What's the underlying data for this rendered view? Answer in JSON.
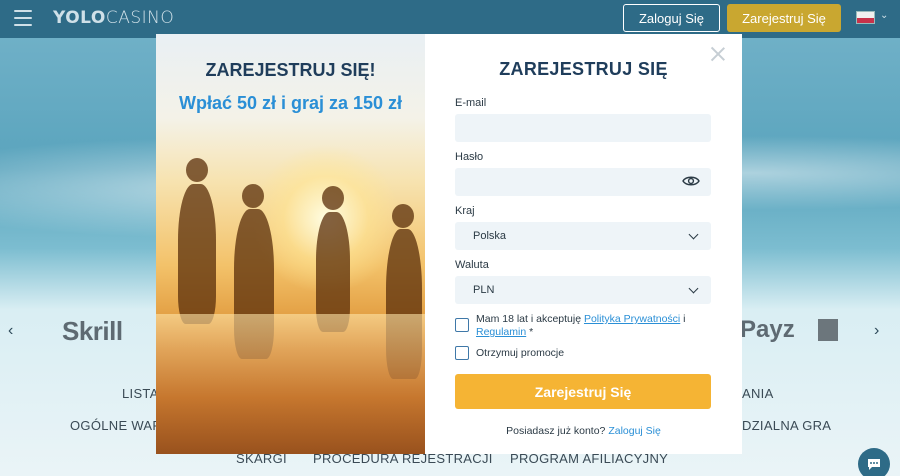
{
  "header": {
    "logo_bold": "YOLO",
    "logo_light": "CASINO",
    "login_label": "Zaloguj Się",
    "register_label": "Zarejestruj Się"
  },
  "background": {
    "payment_logos": [
      "Skrill",
      "Payz"
    ],
    "footer_links": [
      "LISTA",
      "ANIA",
      "OGÓLNE WAR",
      "DZIALNA GRA",
      "SKARGI",
      "PROCEDURA REJESTRACJI",
      "PROGRAM AFILIACYJNY"
    ]
  },
  "modal": {
    "promo_title": "ZAREJESTRUJ SIĘ!",
    "promo_subtitle": "Wpłać 50 zł i graj za 150 zł",
    "form_title": "ZAREJESTRUJ SIĘ",
    "email_label": "E-mail",
    "email_value": "",
    "password_label": "Hasło",
    "password_value": "",
    "country_label": "Kraj",
    "country_value": "Polska",
    "currency_label": "Waluta",
    "currency_value": "PLN",
    "terms_prefix": "Mam 18 lat i akceptuję ",
    "terms_link1": "Polityka Prywatności",
    "terms_mid": " i ",
    "terms_link2": "Regulamin",
    "terms_suffix": " *",
    "promo_checkbox": "Otrzymuj promocje",
    "submit_label": "Zarejestruj Się",
    "have_account": "Posiadasz już konto? ",
    "login_link": "Zaloguj Się"
  },
  "colors": {
    "header_bg": "#2e6b87",
    "register_btn": "#c9a730",
    "submit_btn": "#f5b434",
    "title": "#1f3d5b",
    "accent_blue": "#2a8fd6"
  },
  "icons": {
    "menu": "hamburger-icon",
    "close": "close-icon",
    "password_toggle": "eye-icon",
    "select": "chevron-down-icon",
    "chat": "chat-icon"
  }
}
